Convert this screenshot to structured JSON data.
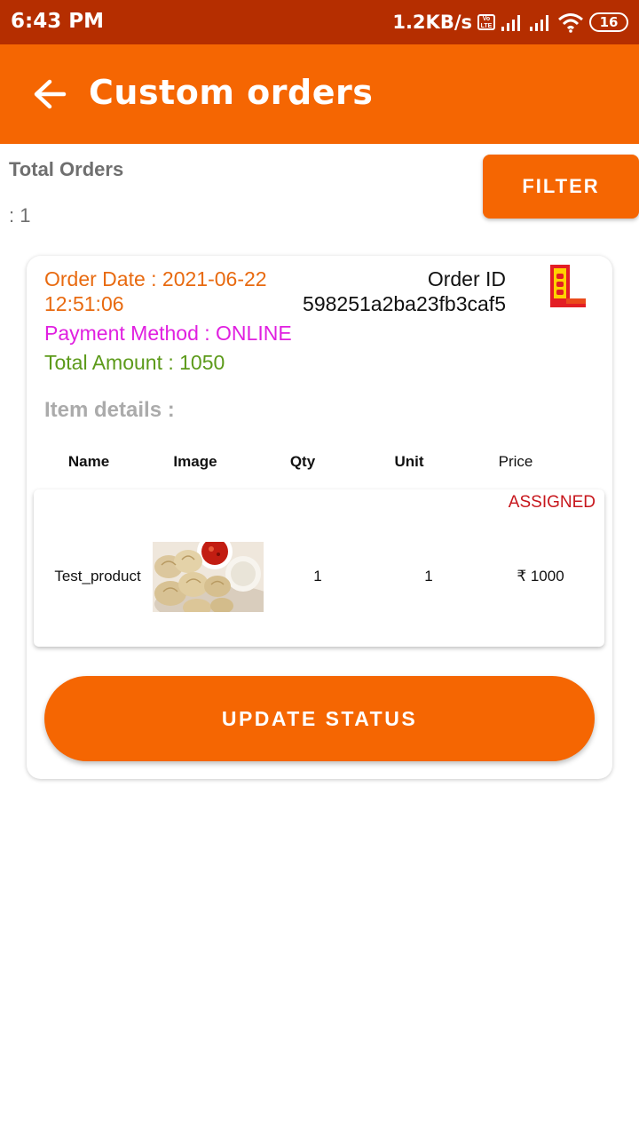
{
  "status_bar": {
    "time": "6:43 PM",
    "net_speed": "1.2KB/s",
    "volte": "Vo LTE",
    "battery": "16"
  },
  "app_bar": {
    "title": "Custom orders"
  },
  "summary": {
    "total_label": "Total Orders",
    "total_count": ": 1",
    "filter_label": "FILTER"
  },
  "order": {
    "date_line1": "Order Date : 2021-06-22",
    "date_line2": "12:51:06",
    "id_label": "Order ID",
    "id_value": "598251a2ba23fb3caf5",
    "payment": "Payment Method : ONLINE",
    "total_amount": "Total Amount : 1050",
    "item_details_label": "Item details :",
    "columns": [
      "Name",
      "Image",
      "Qty",
      "Unit",
      "Price"
    ],
    "items": [
      {
        "status": "ASSIGNED",
        "name": "Test_product",
        "image_icon": "momos-food-image",
        "qty": "1",
        "unit": "1",
        "price": "₹ 1000"
      }
    ],
    "update_label": "UPDATE STATUS"
  },
  "colors": {
    "accent": "#F56602",
    "status_bar": "#B52E00",
    "order_date": "#E86A10",
    "payment": "#E020E0",
    "total_amount": "#5C9A1A",
    "assigned": "#C7161C"
  }
}
